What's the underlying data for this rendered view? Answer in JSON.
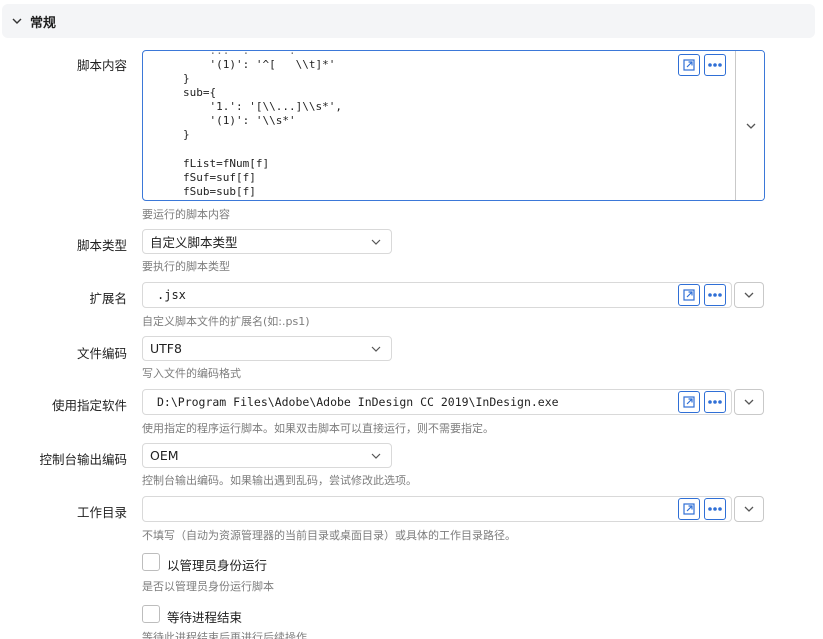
{
  "section": {
    "title": "常规"
  },
  "script_content": {
    "label": "脚本内容",
    "lines": [
      "    '(1)': '^[   \\\\t]*'",
      "}",
      "sub={",
      "    '1.': '[\\\\...]\\\\s*',",
      "    '(1)': '\\\\s*'",
      "}",
      "",
      "fList=fNum[f]",
      "fSuf=suf[f]",
      "fSub=sub[f]"
    ],
    "hint": "要运行的脚本内容"
  },
  "script_type": {
    "label": "脚本类型",
    "value": "自定义脚本类型",
    "hint": "要执行的脚本类型"
  },
  "extension": {
    "label": "扩展名",
    "value": ".jsx",
    "hint": "自定义脚本文件的扩展名(如:.ps1)"
  },
  "file_encoding": {
    "label": "文件编码",
    "value": "UTF8",
    "hint": "写入文件的编码格式"
  },
  "software": {
    "label": "使用指定软件",
    "value": "D:\\Program Files\\Adobe\\Adobe InDesign CC 2019\\InDesign.exe",
    "hint": "使用指定的程序运行脚本。如果双击脚本可以直接运行，则不需要指定。"
  },
  "console_encoding": {
    "label": "控制台输出编码",
    "value": "OEM",
    "hint": "控制台输出编码。如果输出遇到乱码，尝试修改此选项。"
  },
  "work_dir": {
    "label": "工作目录",
    "value": "",
    "hint": "不填写（自动为资源管理器的当前目录或桌面目录）或具体的工作目录路径。"
  },
  "run_as_admin": {
    "label": "以管理员身份运行",
    "hint": "是否以管理员身份运行脚本",
    "checked": false
  },
  "wait_exit": {
    "label": "等待进程结束",
    "hint": "等待此进程结束后再进行后续操作",
    "checked": false
  },
  "colors": {
    "accent": "#3b78d8",
    "border": "#d9d9d9",
    "hint": "#7d7d7d"
  }
}
